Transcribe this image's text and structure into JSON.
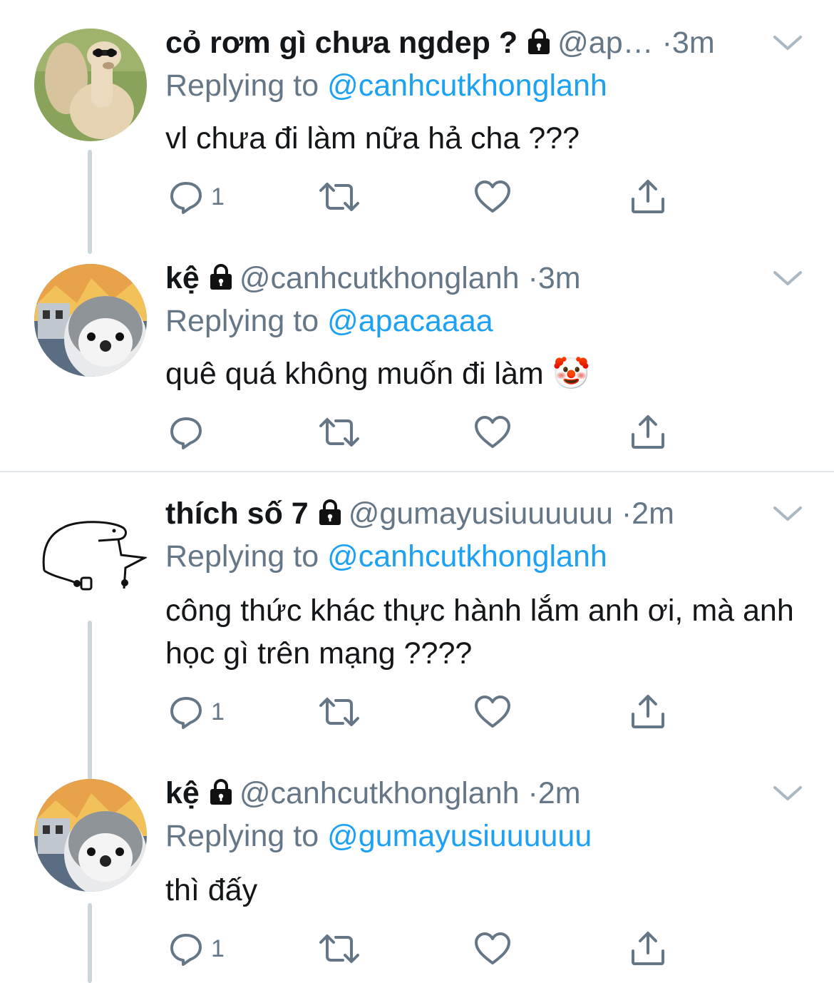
{
  "colors": {
    "accent": "#1da1f2",
    "secondary_text": "#657786",
    "thread_line": "#ccd6dd",
    "divider": "#e1e8ed"
  },
  "icons": [
    "lock-icon",
    "chevron-down-icon",
    "reply-icon",
    "retweet-icon",
    "like-icon",
    "share-icon"
  ],
  "tweets": [
    {
      "name": "cỏ rơm gì chưa ngdep ?",
      "handle": "@ap…",
      "separator": "·",
      "time": "3m",
      "replying_prefix": "Replying to",
      "replying_to": "@canhcutkhonglanh",
      "text": "vl chưa đi làm nữa hả cha ???",
      "reply_count": "1",
      "avatar": "alpaca-avatar"
    },
    {
      "name": "kệ",
      "handle": "@canhcutkhonglanh",
      "separator": "·",
      "time": "3m",
      "replying_prefix": "Replying to",
      "replying_to": "@apacaaaa",
      "text": "quê quá không muốn đi làm 🤡",
      "reply_count": "",
      "avatar": "penguin-avatar"
    },
    {
      "name": "thích số 7",
      "handle": "@gumayusiuuuuuu",
      "separator": "·",
      "time": "2m",
      "replying_prefix": "Replying to",
      "replying_to": "@canhcutkhonglanh",
      "text": "công thức khác thực hành lắm anh ơi, mà anh học gì trên mạng ????",
      "reply_count": "1",
      "avatar": "doodle-avatar"
    },
    {
      "name": "kệ",
      "handle": "@canhcutkhonglanh",
      "separator": "·",
      "time": "2m",
      "replying_prefix": "Replying to",
      "replying_to": "@gumayusiuuuuuu",
      "text": "thì đấy",
      "reply_count": "1",
      "avatar": "penguin-avatar"
    }
  ]
}
